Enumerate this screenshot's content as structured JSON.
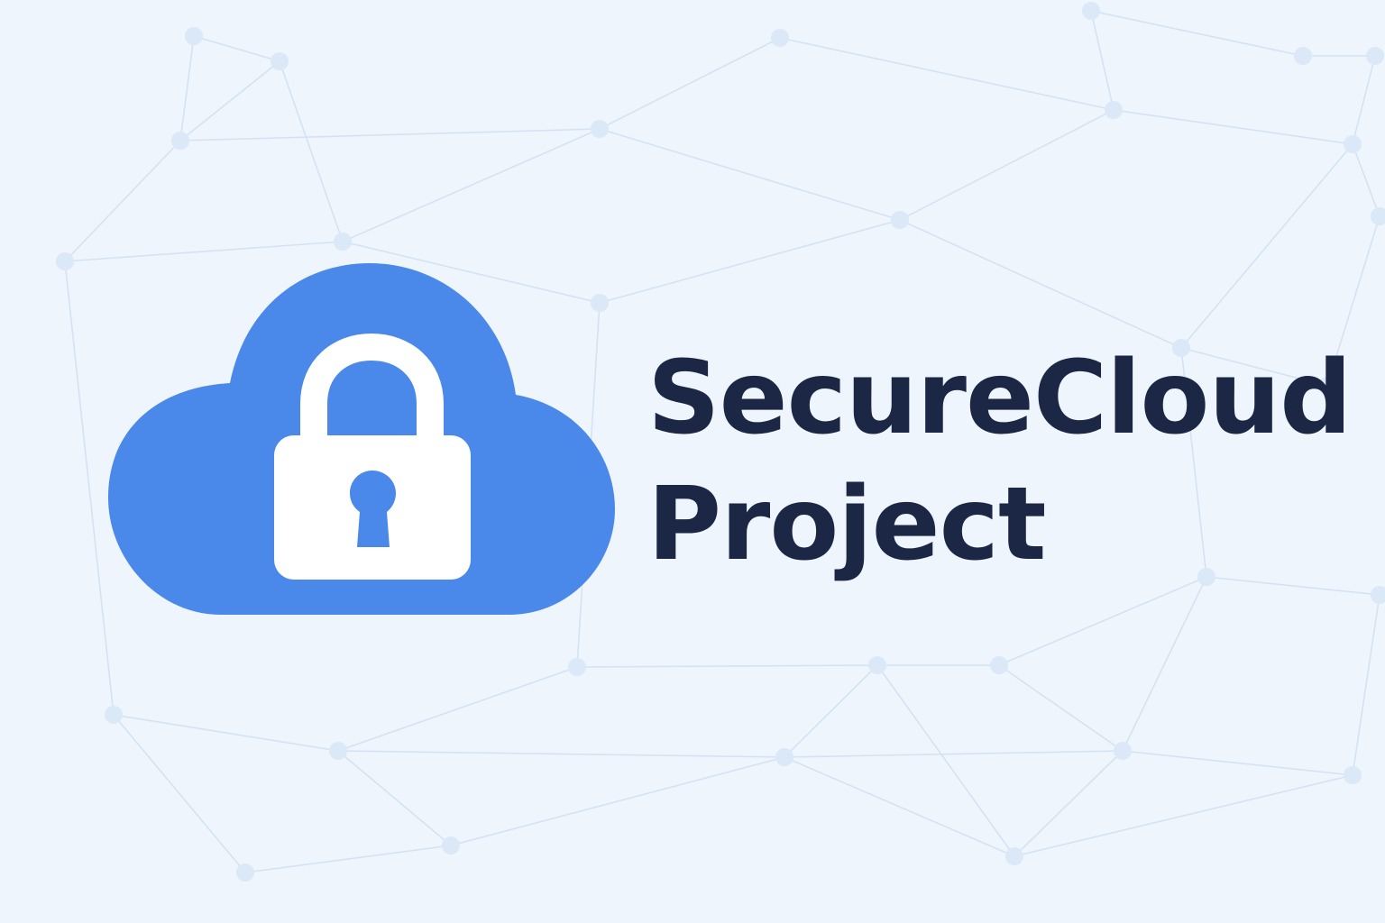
{
  "brand": {
    "title_line1": "SecureCloud",
    "title_line2": "Project"
  },
  "icons": {
    "logo": "cloud-lock-icon",
    "background": "network-mesh-pattern"
  },
  "colors": {
    "background": "#eef5fd",
    "network_lines": "#d3e3f4",
    "network_nodes": "#dbe8f7",
    "cloud": "#4a88ea",
    "lock": "#ffffff",
    "text": "#1b2744"
  }
}
